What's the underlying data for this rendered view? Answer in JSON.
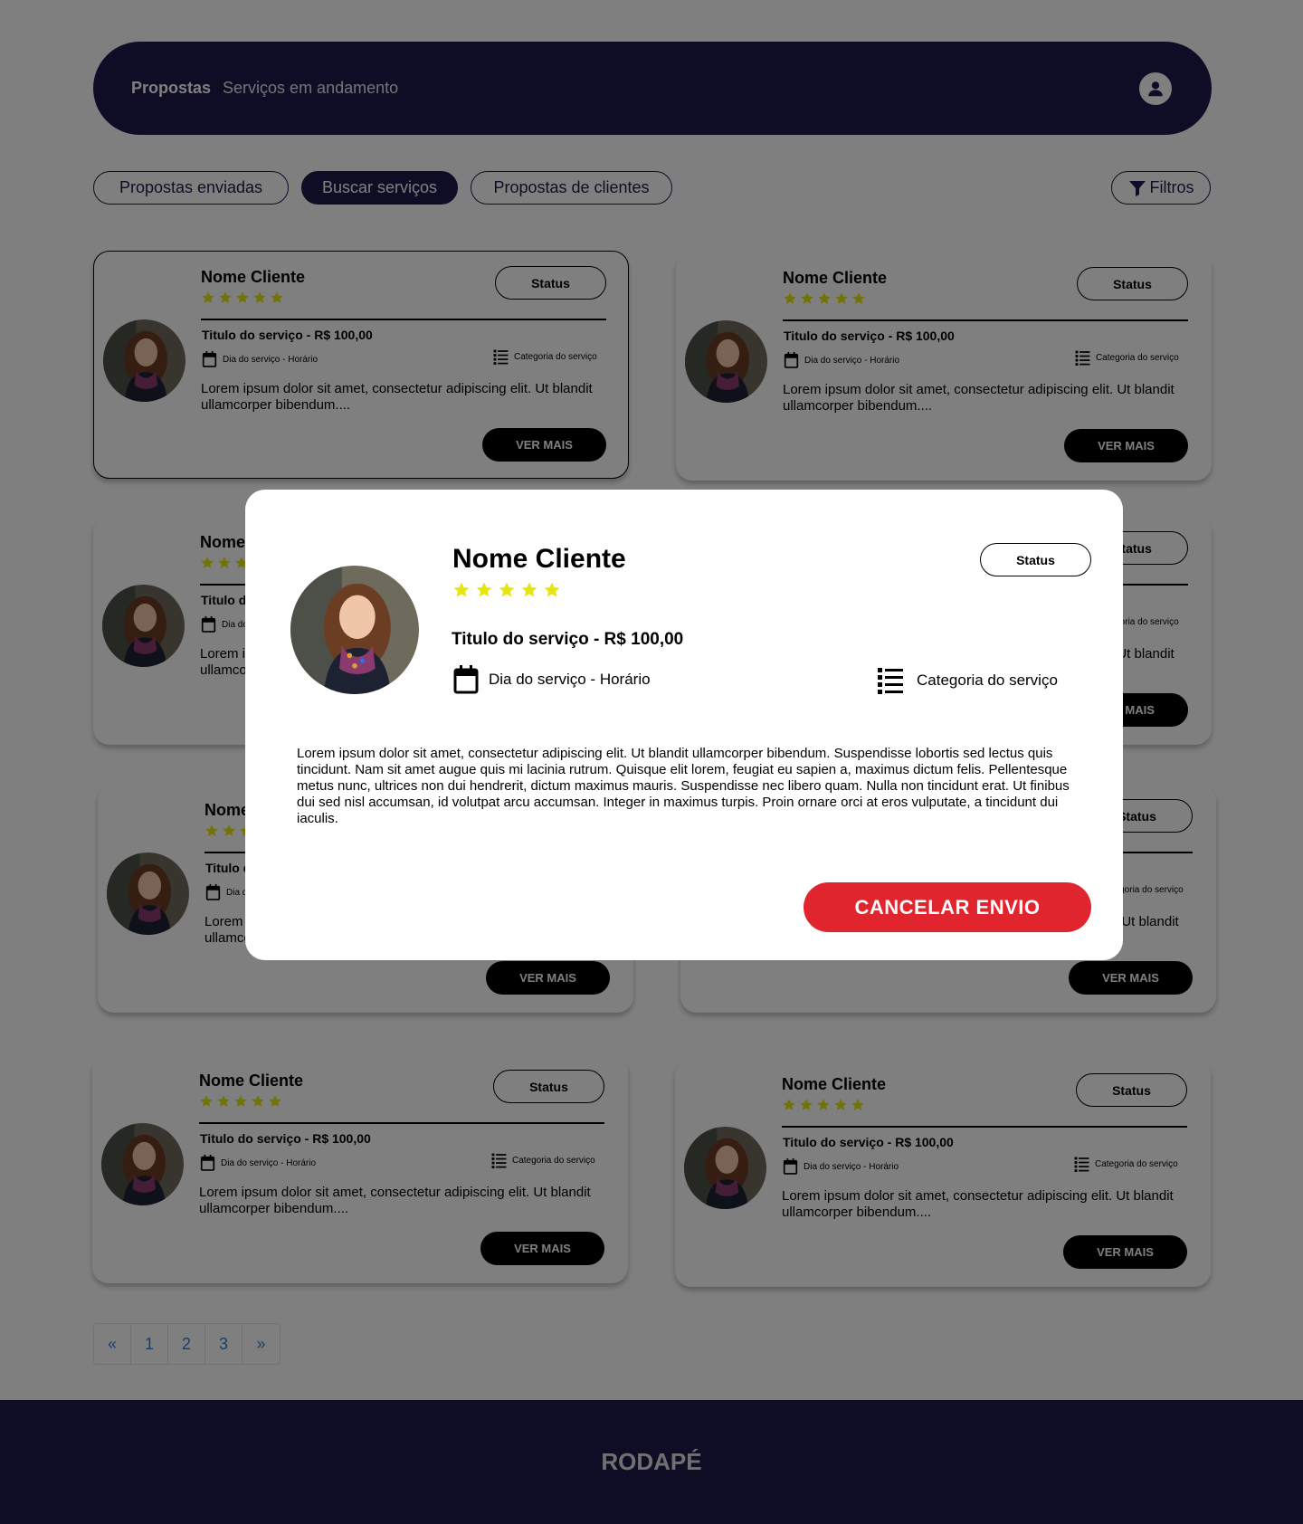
{
  "header": {
    "title": "Propostas",
    "subtitle": "Serviços em andamento",
    "user_icon": "user-icon"
  },
  "tabs": [
    {
      "label": "Propostas enviadas",
      "active": false
    },
    {
      "label": "Buscar serviços",
      "active": true
    },
    {
      "label": "Propostas de clientes",
      "active": false
    }
  ],
  "filter": {
    "label": "Filtros",
    "icon": "filter-icon"
  },
  "card": {
    "name": "Nome Cliente",
    "rating": 5,
    "status": "Status",
    "service_title": "Titulo do serviço - R$ 100,00",
    "date_time": "Dia do serviço - Horário",
    "category": "Categoria do serviço",
    "description": "Lorem ipsum dolor sit amet, consectetur adipiscing elit. Ut blandit ullamcorper bibendum....",
    "button": "VER MAIS"
  },
  "pagination": [
    "«",
    "1",
    "2",
    "3",
    "»"
  ],
  "footer": {
    "label": "RODAPÉ"
  },
  "modal": {
    "name": "Nome Cliente",
    "rating": 5,
    "status": "Status",
    "service_title": "Titulo do serviço - R$ 100,00",
    "date_time": "Dia do serviço - Horário",
    "category": "Categoria do serviço",
    "description": "Lorem ipsum dolor sit amet, consectetur adipiscing elit. Ut blandit ullamcorper bibendum. Suspendisse lobortis sed lectus quis tincidunt. Nam sit amet augue quis mi lacinia rutrum. Quisque elit lorem, feugiat eu sapien a, maximus dictum felis. Pellentesque metus nunc, ultrices non dui hendrerit, dictum maximus mauris. Suspendisse nec libero quam. Nulla non tincidunt erat. Ut finibus dui sed nisl accumsan, id volutpat arcu accumsan. Integer in maximus turpis. Proin ornare orci at eros vulputate, a tincidunt dui iaculis.",
    "cancel_button": "CANCELAR ENVIO"
  },
  "colors": {
    "primary": "#1f1b4d",
    "star": "#e5e60f",
    "danger": "#e0252f",
    "link": "#2f7fd6"
  }
}
